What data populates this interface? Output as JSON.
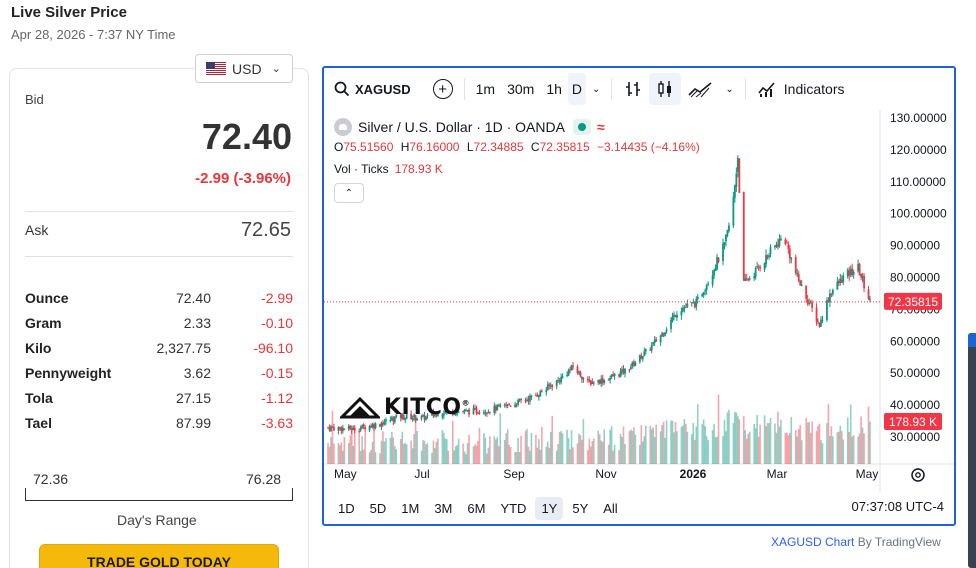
{
  "page": {
    "title": "Live Silver Price",
    "subtitle": "Apr 28, 2026 - 7:37 NY Time"
  },
  "currency": {
    "selected": "USD"
  },
  "quote": {
    "bid_label": "Bid",
    "bid": "72.40",
    "change": "-2.99 (-3.96%)",
    "ask_label": "Ask",
    "ask": "72.65"
  },
  "units": [
    {
      "name": "Ounce",
      "price": "72.40",
      "change": "-2.99"
    },
    {
      "name": "Gram",
      "price": "2.33",
      "change": "-0.10"
    },
    {
      "name": "Kilo",
      "price": "2,327.75",
      "change": "-96.10"
    },
    {
      "name": "Pennyweight",
      "price": "3.62",
      "change": "-0.15"
    },
    {
      "name": "Tola",
      "price": "27.15",
      "change": "-1.12"
    },
    {
      "name": "Tael",
      "price": "87.99",
      "change": "-3.63"
    }
  ],
  "days_range": {
    "low": "72.36",
    "high": "76.28",
    "label": "Day's Range"
  },
  "trade_button": "TRADE GOLD TODAY",
  "chart_toolbar": {
    "symbol": "XAGUSD",
    "intervals": [
      "1m",
      "30m",
      "1h",
      "D"
    ],
    "active_interval": "D",
    "indicators_label": "Indicators"
  },
  "chart_legend": {
    "title": "Silver / U.S. Dollar · 1D · OANDA",
    "o_label": "O",
    "o": "75.51560",
    "h_label": "H",
    "h": "76.16000",
    "l_label": "L",
    "l": "72.34885",
    "c_label": "C",
    "c": "72.35815",
    "chg": "−3.14435 (−4.16%)",
    "vol_label": "Vol · Ticks",
    "vol": "178.93 K"
  },
  "chart_ranges": [
    "1D",
    "5D",
    "1M",
    "3M",
    "6M",
    "YTD",
    "1Y",
    "5Y",
    "All"
  ],
  "active_range": "1Y",
  "time_readout": "07:37:08 UTC-4",
  "attribution": {
    "link": "XAGUSD Chart",
    "rest": " By TradingView"
  },
  "brand": "KITCO",
  "colors": {
    "up": "#089981",
    "down": "#f23645",
    "accent": "#2962ff",
    "border": "#1e63d6",
    "trade": "#f5b90b"
  },
  "chart_data": {
    "type": "line",
    "title": "Silver / U.S. Dollar · 1D · OANDA",
    "x_tick_labels": [
      "May",
      "Jul",
      "Sep",
      "Nov",
      "2026",
      "Mar",
      "May"
    ],
    "y_tick_labels": [
      "130.00000",
      "120.00000",
      "110.00000",
      "100.00000",
      "90.00000",
      "80.00000",
      "70.00000",
      "60.00000",
      "50.00000",
      "40.00000",
      "30.00000"
    ],
    "ylim": [
      30,
      130
    ],
    "last_price_label": "72.35815",
    "volume_label": "178.93 K",
    "series": [
      {
        "name": "XAGUSD",
        "x": [
          "2025-04-28",
          "2025-05-15",
          "2025-06-01",
          "2025-06-15",
          "2025-07-01",
          "2025-07-15",
          "2025-08-01",
          "2025-08-15",
          "2025-09-01",
          "2025-09-15",
          "2025-10-01",
          "2025-10-10",
          "2025-10-20",
          "2025-11-01",
          "2025-11-15",
          "2025-12-01",
          "2025-12-10",
          "2025-12-20",
          "2026-01-01",
          "2026-01-10",
          "2026-01-20",
          "2026-01-25",
          "2026-01-29",
          "2026-02-02",
          "2026-02-10",
          "2026-02-20",
          "2026-03-01",
          "2026-03-10",
          "2026-03-20",
          "2026-03-25",
          "2026-04-01",
          "2026-04-10",
          "2026-04-20",
          "2026-04-28"
        ],
        "values": [
          33,
          32.5,
          34,
          36.5,
          36,
          38,
          38,
          38.5,
          40.5,
          43,
          48,
          52,
          47,
          48,
          51,
          58,
          63,
          70,
          72,
          80,
          90,
          100,
          118,
          78,
          82,
          88,
          93,
          80,
          70,
          65,
          75,
          80,
          83,
          72.36
        ]
      }
    ]
  }
}
